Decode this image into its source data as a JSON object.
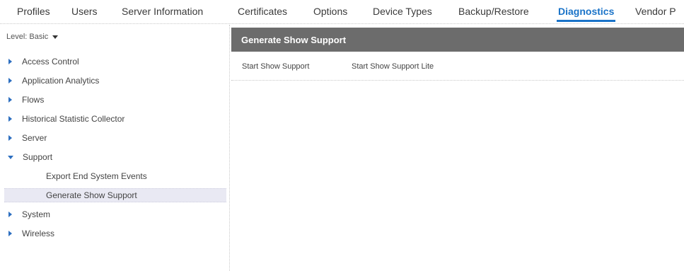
{
  "tabs": [
    {
      "label": "Profiles",
      "active": false
    },
    {
      "label": "Users",
      "active": false
    },
    {
      "label": "Server Information",
      "active": false
    },
    {
      "label": "Certificates",
      "active": false
    },
    {
      "label": "Options",
      "active": false
    },
    {
      "label": "Device Types",
      "active": false
    },
    {
      "label": "Backup/Restore",
      "active": false
    },
    {
      "label": "Diagnostics",
      "active": true
    },
    {
      "label": "Vendor P",
      "active": false
    }
  ],
  "level": {
    "label": "Level: Basic"
  },
  "tree": [
    {
      "label": "Access Control"
    },
    {
      "label": "Application Analytics"
    },
    {
      "label": "Flows"
    },
    {
      "label": "Historical Statistic Collector"
    },
    {
      "label": "Server"
    },
    {
      "label": "Support",
      "expanded": true
    },
    {
      "label": "Export End System Events",
      "child": true
    },
    {
      "label": "Generate Show Support",
      "child": true,
      "selected": true
    },
    {
      "label": "System"
    },
    {
      "label": "Wireless"
    }
  ],
  "panel": {
    "title": "Generate Show Support",
    "actions": [
      {
        "label": "Start Show Support"
      },
      {
        "label": "Start Show Support Lite"
      }
    ]
  },
  "colors": {
    "accent": "#1a73c8",
    "tree_arrow": "#2d6fc0",
    "header_bg": "#6c6c6c",
    "selected_bg": "#e9e9f3"
  }
}
